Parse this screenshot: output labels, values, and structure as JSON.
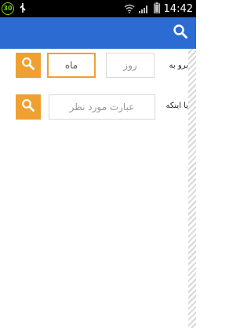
{
  "status_bar": {
    "notification_badge": "30",
    "time": "14:42",
    "icons": [
      "notification-badge",
      "usb-icon",
      "wifi-icon",
      "signal-icon",
      "battery-icon"
    ]
  },
  "app_bar": {
    "color": "#2b6bd2",
    "search_icon": "search-icon"
  },
  "form": {
    "row1": {
      "label": "برو به",
      "day_placeholder": "روز",
      "month_placeholder": "ماه"
    },
    "row2": {
      "label": "یا اینکه",
      "query_placeholder": "عبارت مورد نظر"
    },
    "button_color": "#f0a030"
  }
}
